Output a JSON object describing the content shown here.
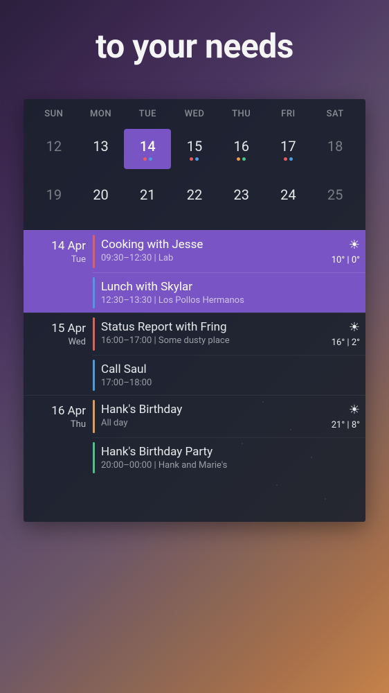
{
  "headline": "to your needs",
  "colors": {
    "red": "#e85c5c",
    "blue": "#4a9de0",
    "green": "#4ac48a",
    "orange": "#e89a4a"
  },
  "calendar": {
    "day_labels": [
      "SUN",
      "MON",
      "TUE",
      "WED",
      "THU",
      "FRI",
      "SAT"
    ],
    "rows": [
      [
        {
          "n": "12",
          "dim": true
        },
        {
          "n": "13"
        },
        {
          "n": "14",
          "selected": true,
          "dots": [
            "red",
            "blue"
          ]
        },
        {
          "n": "15",
          "dots": [
            "red",
            "blue"
          ]
        },
        {
          "n": "16",
          "dots": [
            "orange",
            "green"
          ]
        },
        {
          "n": "17",
          "dots": [
            "red",
            "blue"
          ]
        },
        {
          "n": "18",
          "dim": true
        }
      ],
      [
        {
          "n": "19",
          "dim": true
        },
        {
          "n": "20"
        },
        {
          "n": "21"
        },
        {
          "n": "22"
        },
        {
          "n": "23"
        },
        {
          "n": "24"
        },
        {
          "n": "25",
          "dim": true
        }
      ]
    ]
  },
  "agenda": [
    {
      "date": "14 Apr",
      "dow": "Tue",
      "highlight": true,
      "weather": {
        "icon": "☀",
        "temp": "10° | 0°"
      },
      "events": [
        {
          "title": "Cooking with Jesse",
          "time": "09:30–12:30",
          "location": "Lab",
          "accent": "red"
        },
        {
          "title": "Lunch with Skylar",
          "time": "12:30–13:30",
          "location": "Los Pollos Hermanos",
          "accent": "blue"
        }
      ]
    },
    {
      "date": "15 Apr",
      "dow": "Wed",
      "weather": {
        "icon": "☀",
        "temp": "16° | 2°"
      },
      "events": [
        {
          "title": "Status Report with Fring",
          "time": "16:00–17:00",
          "location": "Some dusty place",
          "accent": "red"
        },
        {
          "title": "Call Saul",
          "time": "17:00–18:00",
          "location": "",
          "accent": "blue"
        }
      ]
    },
    {
      "date": "16 Apr",
      "dow": "Thu",
      "weather": {
        "icon": "☀",
        "temp": "21° | 8°"
      },
      "events": [
        {
          "title": "Hank's Birthday",
          "time": "All day",
          "location": "",
          "accent": "orange"
        },
        {
          "title": "Hank's Birthday Party",
          "time": "20:00–00:00",
          "location": "Hank and Marie's",
          "accent": "green"
        }
      ]
    }
  ]
}
